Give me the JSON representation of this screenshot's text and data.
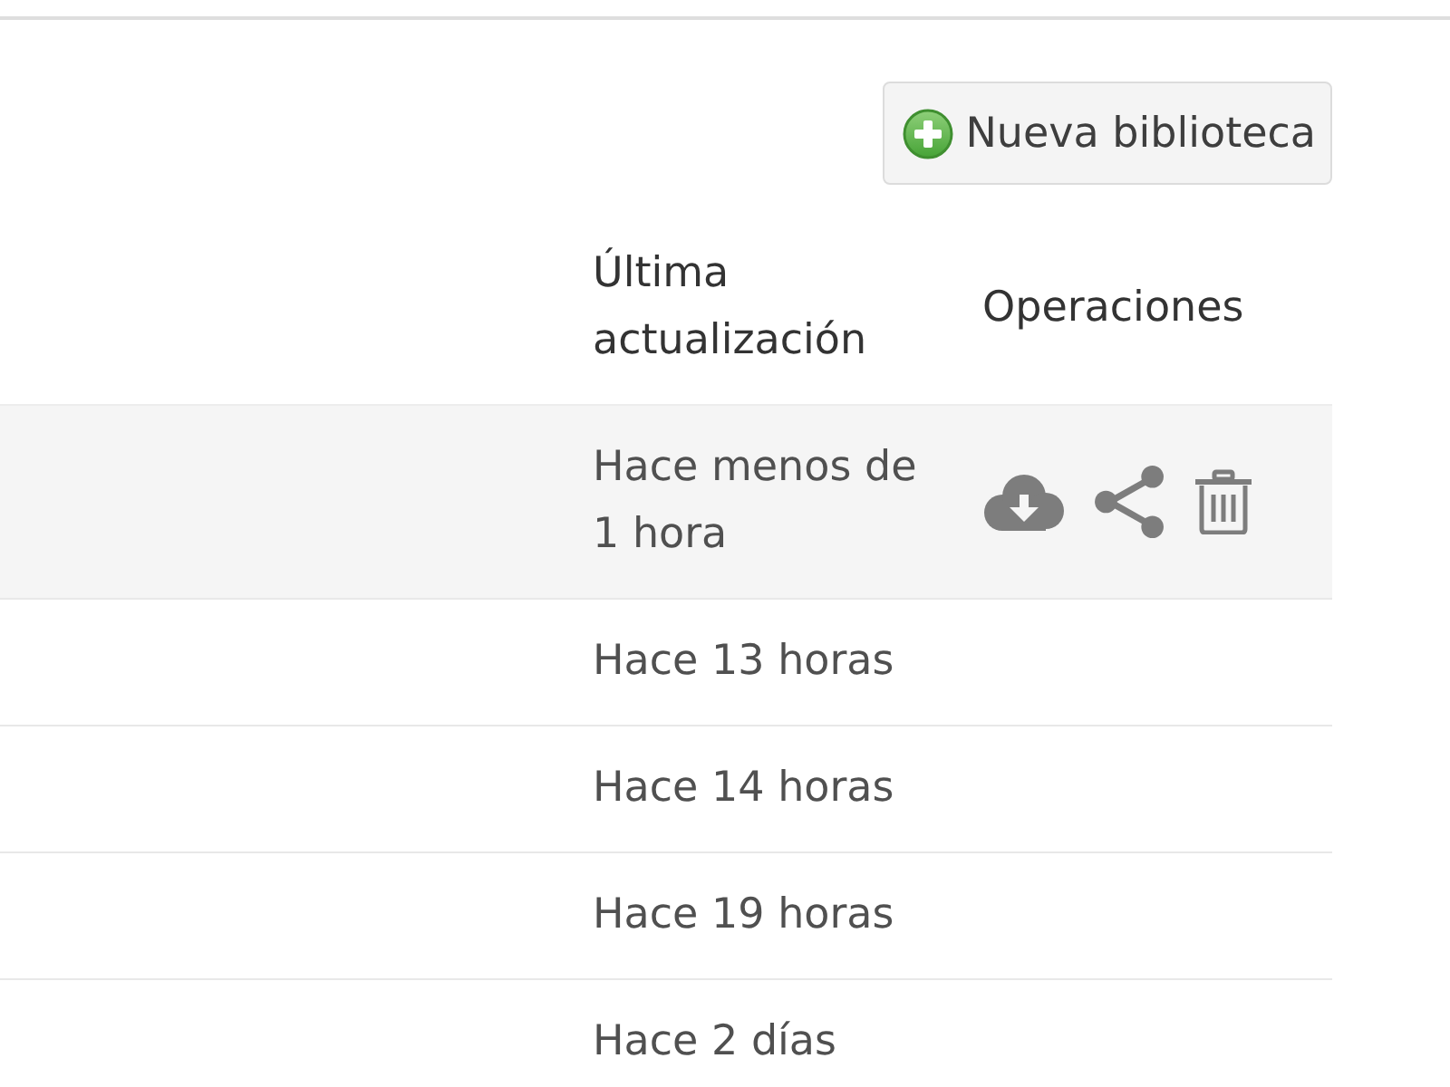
{
  "toolbar": {
    "new_library_button": {
      "label": "Nueva biblioteca"
    }
  },
  "table": {
    "columns": [
      {
        "label": "Última actualización"
      },
      {
        "label": "Operaciones"
      }
    ],
    "rows": [
      {
        "updated": "Hace menos de 1 hora",
        "hovered": true
      },
      {
        "updated": "Hace 13 horas",
        "hovered": false
      },
      {
        "updated": "Hace 14 horas",
        "hovered": false
      },
      {
        "updated": "Hace 19 horas",
        "hovered": false
      },
      {
        "updated": "Hace 2 días",
        "hovered": false
      }
    ]
  }
}
